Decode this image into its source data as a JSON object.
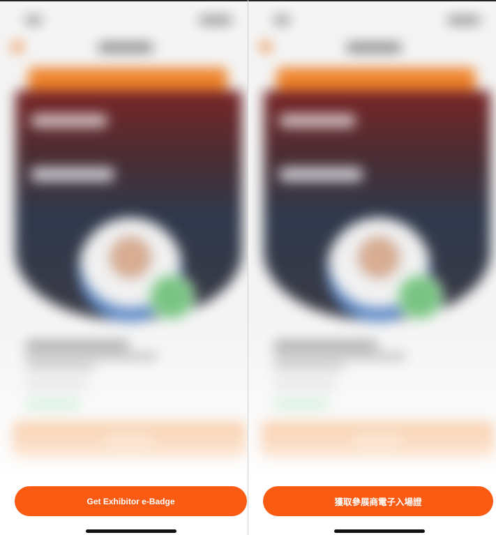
{
  "screens": [
    {
      "cta_label": "Get Exhibitor e-Badge"
    },
    {
      "cta_label": "獲取參展商電子入場證"
    }
  ],
  "colors": {
    "accent": "#fa5b12",
    "badge_orange": "#ee7a1a",
    "verified_green": "#6fc17a"
  },
  "icons": [
    "back-arrow-icon",
    "verified-check-icon"
  ]
}
